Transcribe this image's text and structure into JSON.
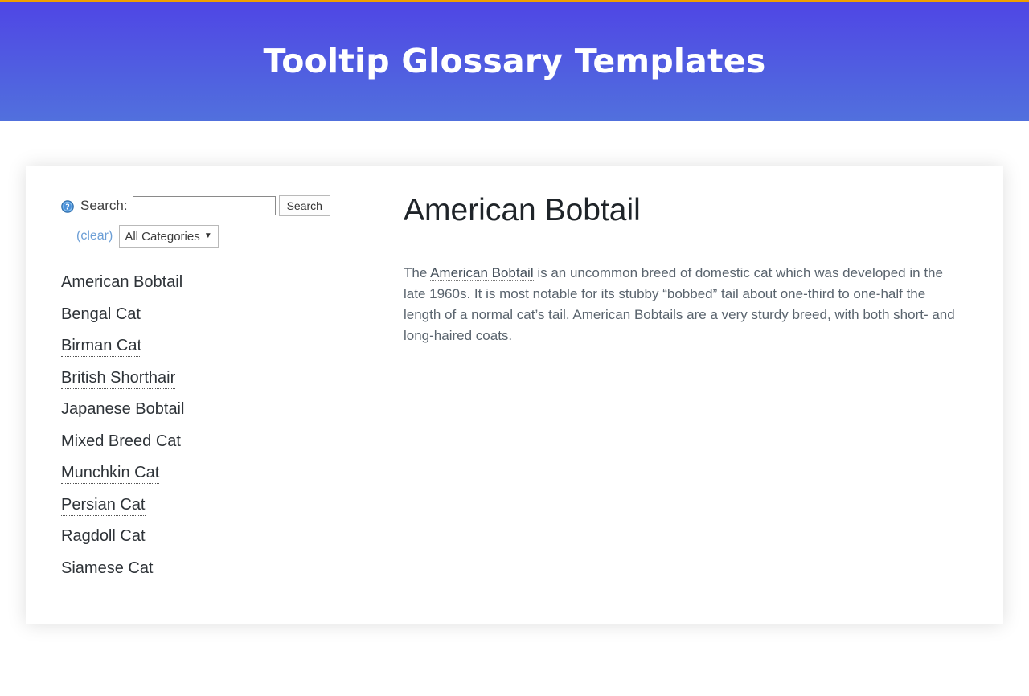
{
  "theme": {
    "accent_bar_color": "#f0a000",
    "header_gradient_from": "#4f46e5",
    "header_gradient_to": "#5170dd",
    "link_color": "#6d9fd6",
    "text_color": "#5a646e"
  },
  "header": {
    "title": "Tooltip Glossary Templates"
  },
  "sidebar": {
    "help_icon": "help-circle-icon",
    "search": {
      "label": "Search:",
      "value": "",
      "placeholder": "",
      "button_label": "Search"
    },
    "clear_link": "(clear)",
    "category_select": {
      "selected": "All Categories",
      "arrow": "▼",
      "options": [
        "All Categories"
      ]
    },
    "terms": [
      "American Bobtail",
      "Bengal Cat",
      "Birman Cat",
      "British Shorthair",
      "Japanese Bobtail",
      "Mixed Breed Cat",
      "Munchkin Cat",
      "Persian Cat",
      "Ragdoll Cat",
      "Siamese Cat"
    ]
  },
  "entry": {
    "title": "American Bobtail",
    "body_lead": "The ",
    "body_term": "American Bobtail",
    "body_rest": " is an uncommon breed of domestic cat which was developed in the late 1960s. It is most notable for its stubby “bobbed” tail about one-third to one-half the length of a normal cat’s tail. American Bobtails are a very sturdy breed, with both short- and long-haired coats."
  }
}
